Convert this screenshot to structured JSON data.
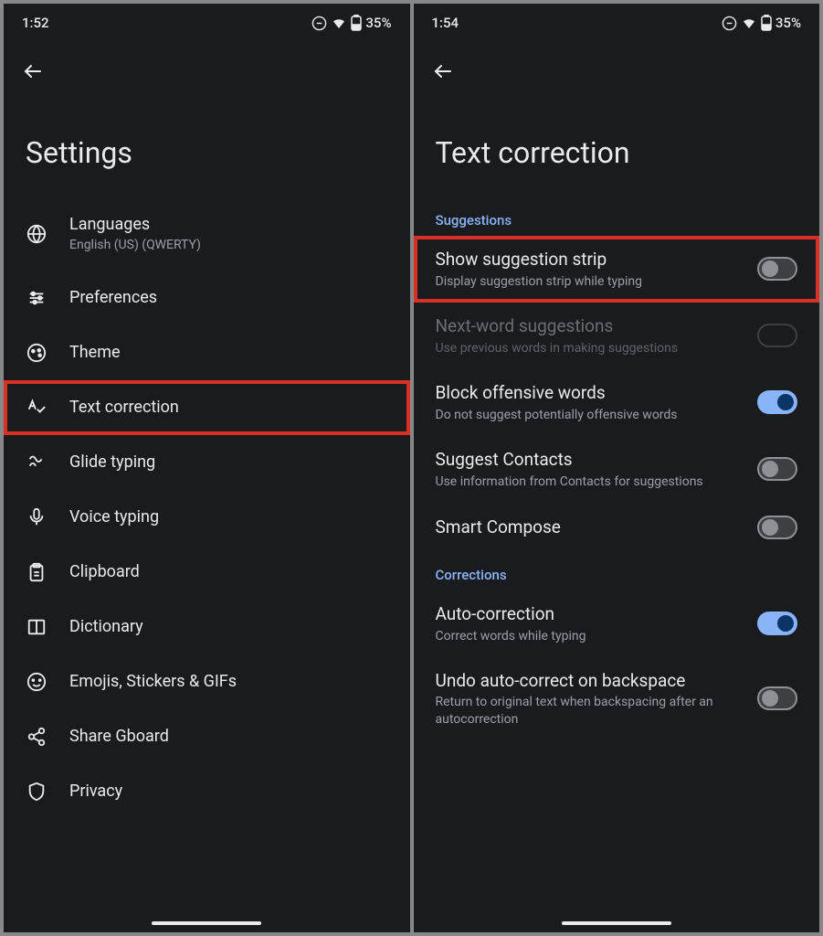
{
  "left": {
    "status": {
      "time": "1:52",
      "battery": "35%"
    },
    "title": "Settings",
    "items": [
      {
        "icon": "globe",
        "title": "Languages",
        "sub": "English (US) (QWERTY)"
      },
      {
        "icon": "sliders",
        "title": "Preferences"
      },
      {
        "icon": "palette",
        "title": "Theme"
      },
      {
        "icon": "spellcheck",
        "title": "Text correction",
        "highlighted": true
      },
      {
        "icon": "gesture",
        "title": "Glide typing"
      },
      {
        "icon": "mic",
        "title": "Voice typing"
      },
      {
        "icon": "clipboard",
        "title": "Clipboard"
      },
      {
        "icon": "book",
        "title": "Dictionary"
      },
      {
        "icon": "emoji",
        "title": "Emojis, Stickers & GIFs"
      },
      {
        "icon": "share",
        "title": "Share Gboard"
      },
      {
        "icon": "shield",
        "title": "Privacy"
      }
    ]
  },
  "right": {
    "status": {
      "time": "1:54",
      "battery": "35%"
    },
    "title": "Text correction",
    "sections": [
      {
        "header": "Suggestions",
        "items": [
          {
            "title": "Show suggestion strip",
            "sub": "Display suggestion strip while typing",
            "toggle": "off",
            "highlighted": true
          },
          {
            "title": "Next-word suggestions",
            "sub": "Use previous words in making suggestions",
            "toggle": "off-dark",
            "disabled": true
          },
          {
            "title": "Block offensive words",
            "sub": "Do not suggest potentially offensive words",
            "toggle": "on"
          },
          {
            "title": "Suggest Contacts",
            "sub": "Use information from Contacts for suggestions",
            "toggle": "off"
          },
          {
            "title": "Smart Compose",
            "toggle": "off"
          }
        ]
      },
      {
        "header": "Corrections",
        "items": [
          {
            "title": "Auto-correction",
            "sub": "Correct words while typing",
            "toggle": "on"
          },
          {
            "title": "Undo auto-correct on backspace",
            "sub": "Return to original text when backspacing after an autocorrection",
            "toggle": "off"
          }
        ]
      }
    ]
  }
}
